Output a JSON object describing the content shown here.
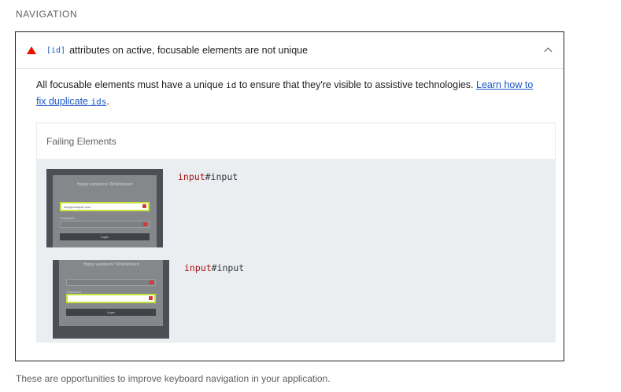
{
  "section": {
    "title": "NAVIGATION"
  },
  "audit": {
    "id_code": "[id]",
    "title": "attributes on active, focusable elements are not unique",
    "description_before": "All focusable elements must have a unique ",
    "description_code": "id",
    "description_after": " to ensure that they're visible to assistive technologies. ",
    "link_text": "Learn how to fix duplicate ",
    "link_code": "ids",
    "description_end": "."
  },
  "details": {
    "header": "Failing Elements",
    "items": [
      {
        "thumbnail": {
          "title": "Happy wanderers' Whistleboard",
          "email_value": "test@example.com",
          "label": "Password",
          "button": "Login",
          "highlight": "email"
        },
        "tag": "input",
        "selector": "#input"
      },
      {
        "thumbnail": {
          "title": "Happy wanderers' Whistleboard",
          "email_value": "test@example.com",
          "label": "Password",
          "button": "Login",
          "highlight": "password"
        },
        "tag": "input",
        "selector": "#input"
      }
    ]
  },
  "footer": {
    "text": "These are opportunities to improve keyboard navigation in your application."
  },
  "colors": {
    "fail": "#eb0f00",
    "link": "#1a56c4",
    "highlight": "#c6e23c",
    "tag": "#a31515"
  }
}
